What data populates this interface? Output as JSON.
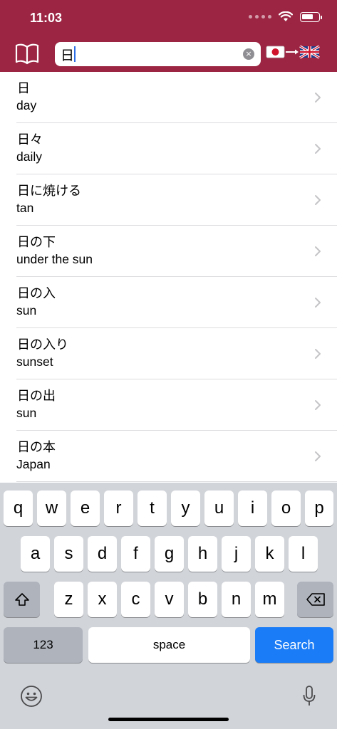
{
  "status_bar": {
    "time": "11:03"
  },
  "search": {
    "value": "日",
    "clear_label": "×"
  },
  "colors": {
    "header": "#9c2543",
    "search_key": "#1a7cf6"
  },
  "lang_toggle": {
    "from_icon": "japan-flag-icon",
    "to_icon": "uk-flag-icon"
  },
  "results": [
    {
      "jp": "日",
      "en": "day"
    },
    {
      "jp": "日々",
      "en": "daily"
    },
    {
      "jp": "日に焼ける",
      "en": "tan"
    },
    {
      "jp": "日の下",
      "en": "under the sun"
    },
    {
      "jp": "日の入",
      "en": "sun"
    },
    {
      "jp": "日の入り",
      "en": "sunset"
    },
    {
      "jp": "日の出",
      "en": "sun"
    },
    {
      "jp": "日の本",
      "en": "Japan"
    }
  ],
  "keyboard": {
    "row1": [
      "q",
      "w",
      "e",
      "r",
      "t",
      "y",
      "u",
      "i",
      "o",
      "p"
    ],
    "row2": [
      "a",
      "s",
      "d",
      "f",
      "g",
      "h",
      "j",
      "k",
      "l"
    ],
    "row3": [
      "z",
      "x",
      "c",
      "v",
      "b",
      "n",
      "m"
    ],
    "numbers_label": "123",
    "space_label": "space",
    "search_label": "Search"
  }
}
